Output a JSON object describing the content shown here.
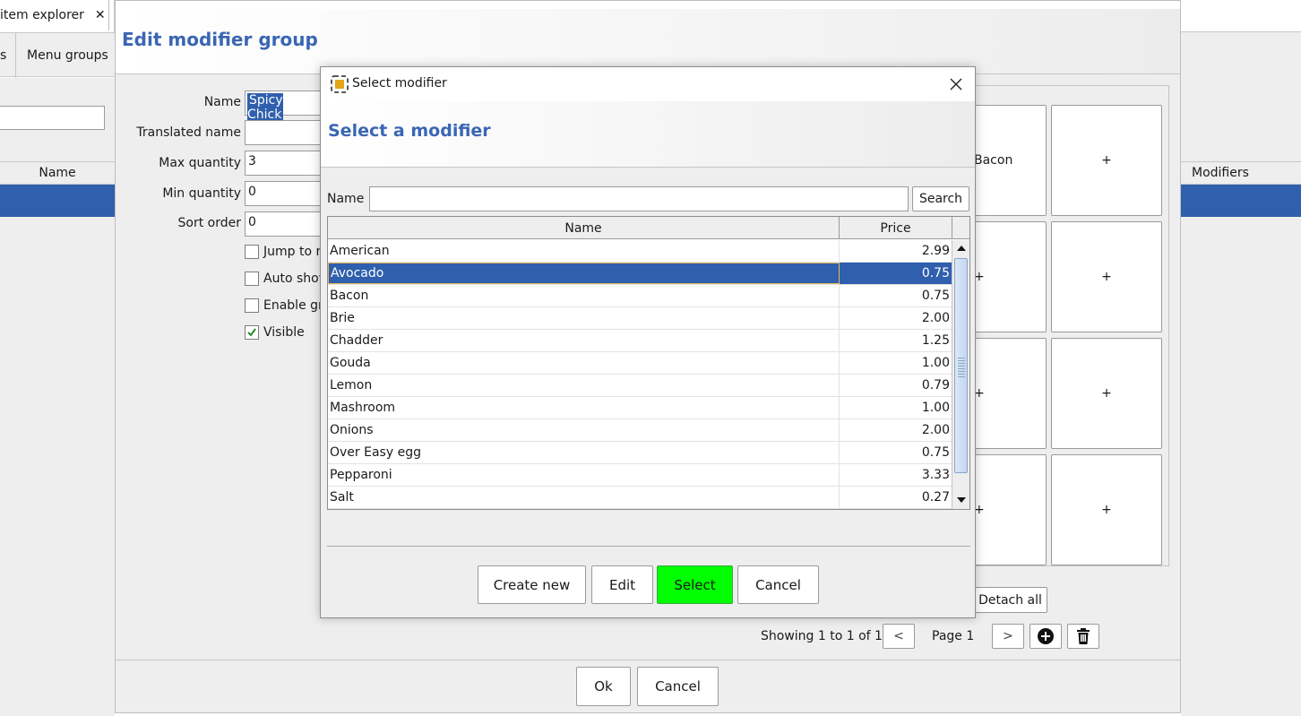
{
  "app": {
    "tab_label": "item explorer",
    "tab_close": "✕",
    "subtabs": [
      "s",
      "Menu groups"
    ],
    "left_column_header": "Name",
    "right_column_header": "Modifiers"
  },
  "edit_dialog": {
    "title": "Edit modifier group",
    "fields": {
      "name_label": "Name",
      "name_value": "Spicy Chick",
      "translated_label": "Translated name",
      "translated_value": "",
      "max_label": "Max quantity",
      "max_value": "3",
      "min_label": "Min quantity",
      "min_value": "0",
      "sort_label": "Sort order",
      "sort_value": "0"
    },
    "checkboxes": [
      {
        "label": "Jump to r",
        "checked": false
      },
      {
        "label": "Auto shov",
        "checked": false
      },
      {
        "label": "Enable gr",
        "checked": false
      },
      {
        "label": "Visible",
        "checked": true
      }
    ],
    "grid_buttons": [
      "Bacon",
      "+",
      "+",
      "+",
      "+",
      "+",
      "+",
      "+"
    ],
    "detach_all": "Detach all",
    "showing_text": "Showing 1 to 1 of 1",
    "prev": "<",
    "page_label": "Page 1",
    "next": ">",
    "ok": "Ok",
    "cancel": "Cancel"
  },
  "select_dialog": {
    "window_title": "Select modifier",
    "header_title": "Select a modifier",
    "name_label": "Name",
    "search_value": "",
    "search_button": "Search",
    "columns": [
      "Name",
      "Price"
    ],
    "rows": [
      {
        "name": "American",
        "price": "2.99"
      },
      {
        "name": "Avocado",
        "price": "0.75"
      },
      {
        "name": "Bacon",
        "price": "0.75"
      },
      {
        "name": "Brie",
        "price": "2.00"
      },
      {
        "name": "Chadder",
        "price": "1.25"
      },
      {
        "name": "Gouda",
        "price": "1.00"
      },
      {
        "name": "Lemon",
        "price": "0.79"
      },
      {
        "name": "Mashroom",
        "price": "1.00"
      },
      {
        "name": "Onions",
        "price": "2.00"
      },
      {
        "name": "Over Easy egg",
        "price": "0.75"
      },
      {
        "name": "Pepparoni",
        "price": "3.33"
      },
      {
        "name": "Salt",
        "price": "0.27"
      }
    ],
    "selected_row": 1,
    "buttons": {
      "create_new": "Create new",
      "edit": "Edit",
      "select": "Select",
      "cancel": "Cancel"
    }
  },
  "colors": {
    "accent_title": "#3a66b4",
    "selection": "#2f5fad",
    "select_button": "#00ff00"
  },
  "icons": [
    "close-icon",
    "app-icon",
    "scroll-up-icon",
    "scroll-down-icon",
    "add-circle-icon",
    "trash-icon"
  ]
}
